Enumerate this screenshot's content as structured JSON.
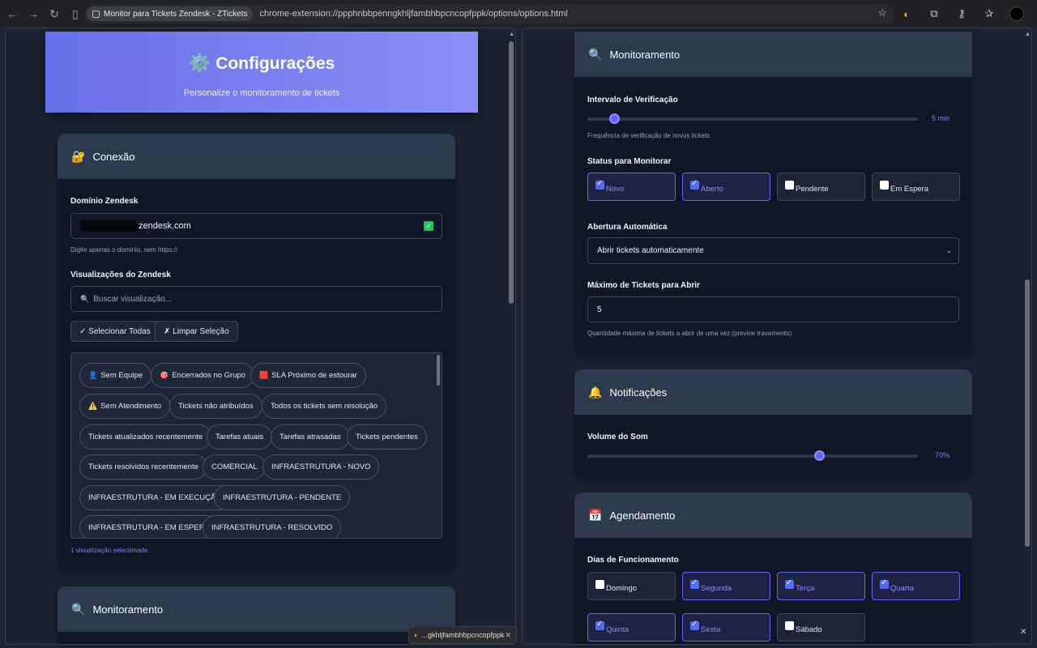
{
  "browser": {
    "tab_chip": "Monitor para Tickets Zendesk - ZTickets",
    "url": "chrome-extension://ppphnbbpenngkhljfambhbpcncopfppk/options/options.html"
  },
  "header": {
    "title": "Configurações",
    "subtitle": "Personalize o monitoramento de tickets"
  },
  "conexao": {
    "title": "Conexão",
    "domain_label": "Domínio Zendesk",
    "domain_value": "zendesk.com",
    "domain_hint": "Digite apenas o domínio, sem https://",
    "views_label": "Visualizações do Zendesk",
    "search_placeholder": "Buscar visualização...",
    "select_all": "✓ Selecionar Todas",
    "clear_selection": "✗ Limpar Seleção",
    "views": [
      {
        "label": "Sem Equipe",
        "emoji": "👤"
      },
      {
        "label": "Encerrados no Grupo",
        "emoji": "🎯"
      },
      {
        "label": "SLA Próximo de estourar",
        "emoji": "🟥"
      },
      {
        "label": "Sem Atendimento",
        "emoji": "⚠️"
      },
      {
        "label": "Tickets não atribuídos",
        "emoji": ""
      },
      {
        "label": "Todos os tickets sem resolução",
        "emoji": ""
      },
      {
        "label": "Tickets atualizados recentemente",
        "emoji": ""
      },
      {
        "label": "Tarefas atuais",
        "emoji": ""
      },
      {
        "label": "Tarefas atrasadas",
        "emoji": ""
      },
      {
        "label": "Tickets pendentes",
        "emoji": ""
      },
      {
        "label": "Tickets resolvidos recentemente",
        "emoji": ""
      },
      {
        "label": "COMERCIAL",
        "emoji": ""
      },
      {
        "label": "INFRAESTRUTURA - NOVO",
        "emoji": ""
      },
      {
        "label": "INFRAESTRUTURA - EM EXECUÇÃO",
        "emoji": ""
      },
      {
        "label": "INFRAESTRUTURA - PENDENTE",
        "emoji": ""
      },
      {
        "label": "INFRAESTRUTURA - EM ESPERA",
        "emoji": ""
      },
      {
        "label": "INFRAESTRUTURA - RESOLVIDO",
        "emoji": ""
      }
    ],
    "selected_count": "1 visualização selecionada"
  },
  "left_monitoramento_title": "Monitoramento",
  "monitoramento": {
    "title": "Monitoramento",
    "interval_label": "Intervalo de Verificação",
    "interval_value": "5 min",
    "interval_fraction": 0.08,
    "interval_hint": "Frequência de verificação de novos tickets",
    "status_label": "Status para Monitorar",
    "statuses": [
      {
        "label": "Novo",
        "checked": true
      },
      {
        "label": "Aberto",
        "checked": true
      },
      {
        "label": "Pendente",
        "checked": false
      },
      {
        "label": "Em Espera",
        "checked": false
      }
    ],
    "auto_open_label": "Abertura Automática",
    "auto_open_value": "Abrir tickets automaticamente",
    "max_label": "Máximo de Tickets para Abrir",
    "max_value": "5",
    "max_hint": "Quantidade máxima de tickets a abrir de uma vez (previne travamento)"
  },
  "notificacoes": {
    "title": "Notificações",
    "volume_label": "Volume do Som",
    "volume_value": "70%",
    "volume_fraction": 0.7
  },
  "agendamento": {
    "title": "Agendamento",
    "days_label": "Dias de Funcionamento",
    "days": [
      {
        "label": "Domingo",
        "checked": false
      },
      {
        "label": "Segunda",
        "checked": true
      },
      {
        "label": "Terça",
        "checked": true
      },
      {
        "label": "Quarta",
        "checked": true
      },
      {
        "label": "Quinta",
        "checked": true
      },
      {
        "label": "Sexta",
        "checked": true
      },
      {
        "label": "Sábado",
        "checked": false
      }
    ]
  },
  "download_tab": "...gkhljfambhbpcncopfppk",
  "colors": {
    "accent": "#6366f1",
    "header_start": "#6670e6",
    "header_end": "#8a8ff7",
    "card": "#0f1626",
    "card_head": "#2d3a4d"
  }
}
